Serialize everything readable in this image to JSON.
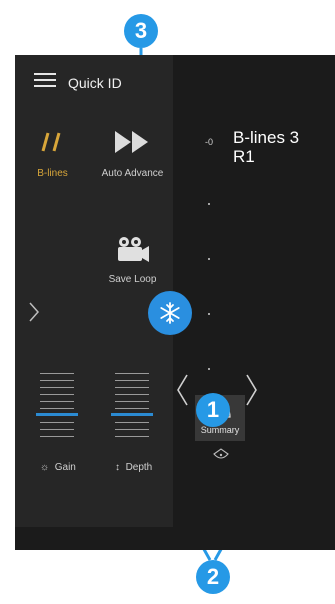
{
  "header": {
    "title": "Quick ID"
  },
  "tools": {
    "blines": {
      "label": "B-lines",
      "icon": "b-lines-icon",
      "color": "#d8a63a"
    },
    "auto_advance": {
      "label": "Auto Advance",
      "icon": "fast-forward-icon"
    },
    "save_loop": {
      "label": "Save Loop",
      "icon": "video-camera-icon"
    }
  },
  "controls": {
    "gain_label": "Gain",
    "depth_label": "Depth"
  },
  "scan": {
    "depth_zero": "0",
    "title_line1": "B-lines  3",
    "title_line2": "R1"
  },
  "summary": {
    "label": "Summary"
  },
  "callouts": {
    "one": "1",
    "two": "2",
    "three": "3"
  },
  "colors": {
    "accent": "#2a8fe0",
    "blines": "#d8a63a",
    "panel": "#262626",
    "background": "#1b1b1b"
  }
}
